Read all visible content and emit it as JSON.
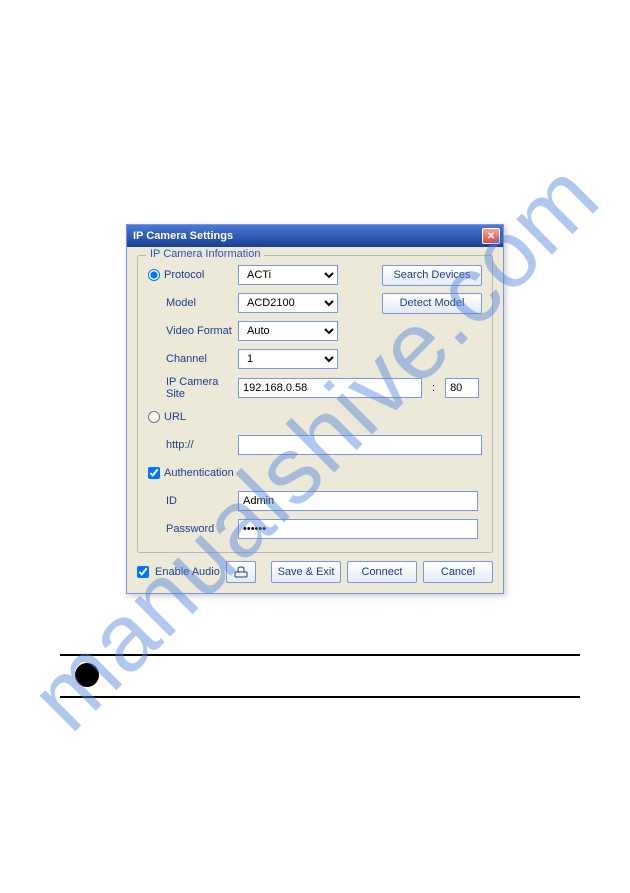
{
  "watermark": "manualshive.com",
  "dialog": {
    "title": "IP Camera Settings",
    "groupTitle": "IP Camera Information",
    "labels": {
      "protocol": "Protocol",
      "model": "Model",
      "videoFormat": "Video Format",
      "channel": "Channel",
      "ipCameraSite": "IP Camera Site",
      "url": "URL",
      "httpPrefix": "http://",
      "authentication": "Authentication",
      "id": "ID",
      "password": "Password",
      "enableAudio": "Enable Audio"
    },
    "values": {
      "protocol": "ACTi",
      "model": "ACD2100",
      "videoFormat": "Auto",
      "channel": "1",
      "ipCameraSite": "192.168.0.58",
      "port": "80",
      "urlValue": "",
      "id": "Admin",
      "password": "••••••",
      "protocolSelected": true,
      "urlSelected": false,
      "authChecked": true,
      "enableAudioChecked": true
    },
    "buttons": {
      "searchDevices": "Search Devices",
      "detectModel": "Detect Model",
      "saveExit": "Save & Exit",
      "connect": "Connect",
      "cancel": "Cancel"
    }
  }
}
